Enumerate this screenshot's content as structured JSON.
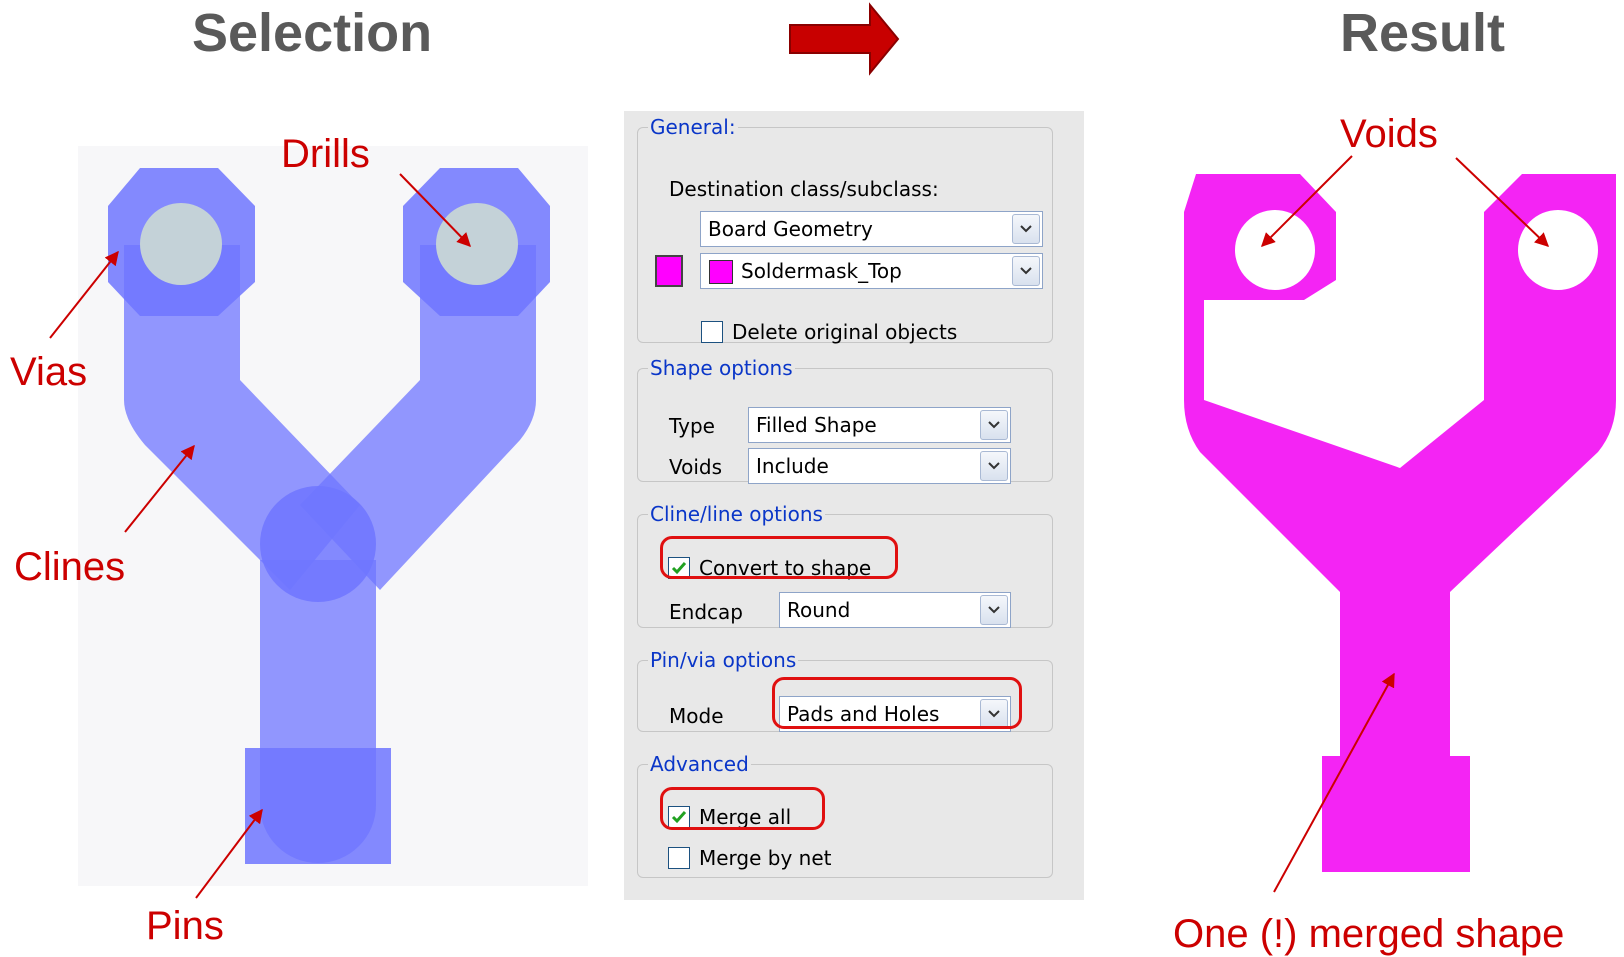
{
  "headings": {
    "selection": "Selection",
    "result": "Result"
  },
  "labels": {
    "drills": "Drills",
    "vias": "Vias",
    "clines": "Clines",
    "pins": "Pins",
    "voids": "Voids",
    "merged": "One (!) merged shape"
  },
  "colors": {
    "selection_fill": "#6f75ff",
    "drill_fill": "#c4d2d8",
    "result_fill": "#f424f4",
    "annotation": "#cc0000",
    "group_title": "#0a36c8",
    "arrow": "#cc0000"
  },
  "dialog": {
    "general": {
      "title": "General:",
      "destination_label": "Destination class/subclass:",
      "class_value": "Board Geometry",
      "subclass_value": "Soldermask_Top",
      "delete_label": "Delete original objects",
      "delete_checked": false
    },
    "shape_options": {
      "title": "Shape options",
      "type_label": "Type",
      "type_value": "Filled Shape",
      "voids_label": "Voids",
      "voids_value": "Include"
    },
    "cline_options": {
      "title": "Cline/line options",
      "convert_label": "Convert to shape",
      "convert_checked": true,
      "endcap_label": "Endcap",
      "endcap_value": "Round"
    },
    "pinvia_options": {
      "title": "Pin/via options",
      "mode_label": "Mode",
      "mode_value": "Pads and Holes"
    },
    "advanced": {
      "title": "Advanced",
      "merge_all_label": "Merge all",
      "merge_all_checked": true,
      "merge_by_net_label": "Merge by net",
      "merge_by_net_checked": false
    }
  }
}
